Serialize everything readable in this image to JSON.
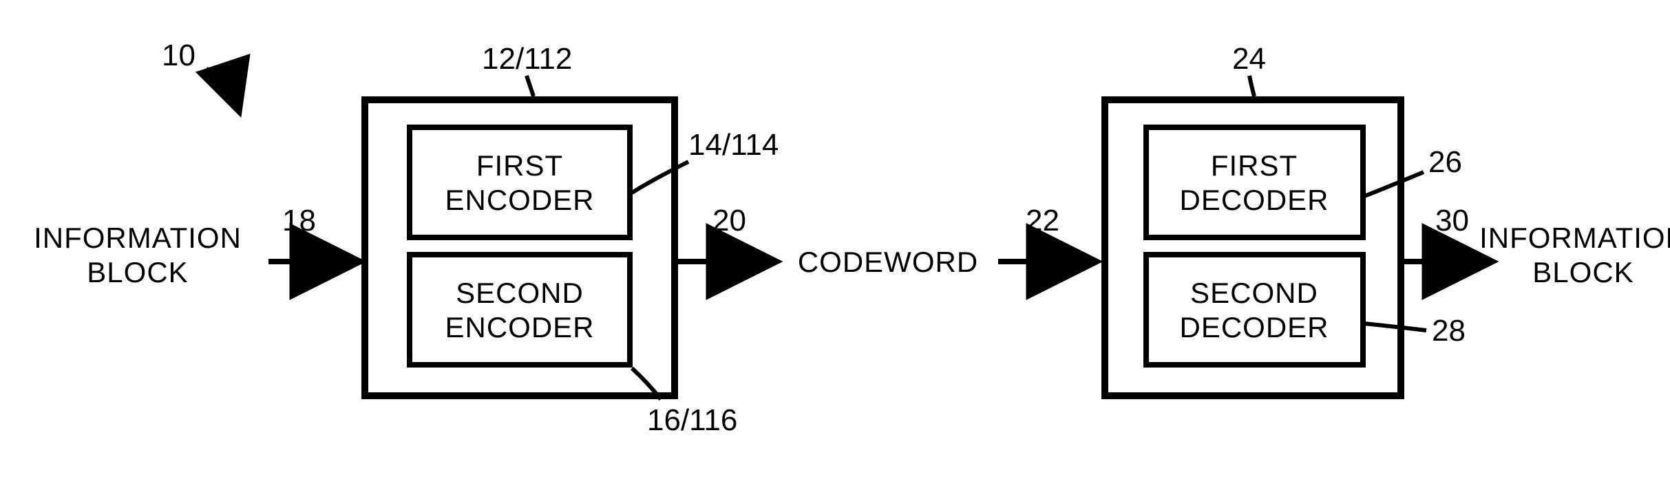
{
  "labels": {
    "info_block_left_l1": "INFORMATION",
    "info_block_left_l2": "BLOCK",
    "first_encoder_l1": "FIRST",
    "first_encoder_l2": "ENCODER",
    "second_encoder_l1": "SECOND",
    "second_encoder_l2": "ENCODER",
    "codeword": "CODEWORD",
    "first_decoder_l1": "FIRST",
    "first_decoder_l2": "DECODER",
    "second_decoder_l1": "SECOND",
    "second_decoder_l2": "DECODER",
    "info_block_right_l1": "INFORMATION",
    "info_block_right_l2": "BLOCK"
  },
  "refs": {
    "n10": "10",
    "n12": "12/112",
    "n14": "14/114",
    "n16": "16/116",
    "n18": "18",
    "n20": "20",
    "n22": "22",
    "n24": "24",
    "n26": "26",
    "n28": "28",
    "n30": "30"
  }
}
